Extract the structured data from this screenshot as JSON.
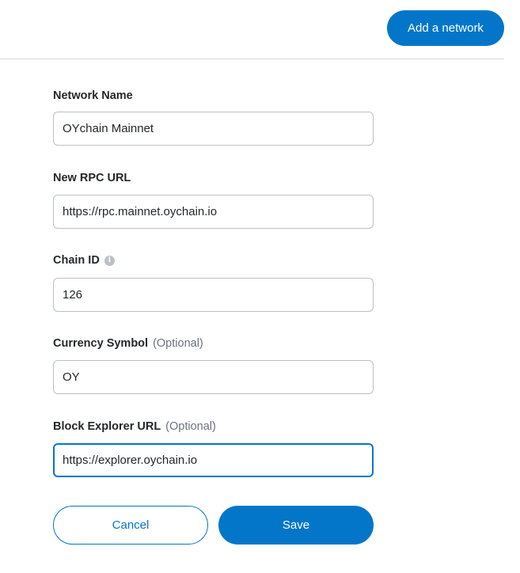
{
  "header": {
    "add_network_label": "Add a network"
  },
  "form": {
    "network_name": {
      "label": "Network Name",
      "value": "OYchain Mainnet"
    },
    "rpc_url": {
      "label": "New RPC URL",
      "value": "https://rpc.mainnet.oychain.io"
    },
    "chain_id": {
      "label": "Chain ID",
      "value": "126",
      "info_icon": "info-icon"
    },
    "currency_symbol": {
      "label": "Currency Symbol",
      "optional": "(Optional)",
      "value": "OY"
    },
    "block_explorer": {
      "label": "Block Explorer URL",
      "optional": "(Optional)",
      "value": "https://explorer.oychain.io"
    }
  },
  "actions": {
    "cancel_label": "Cancel",
    "save_label": "Save"
  },
  "colors": {
    "accent": "#0376c9",
    "border": "#bbc0c5",
    "text": "#24272a",
    "muted": "#6a737d"
  }
}
